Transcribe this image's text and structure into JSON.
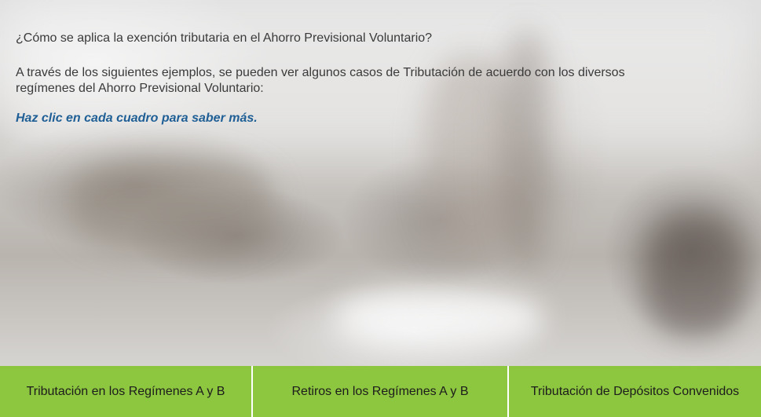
{
  "content": {
    "question": "¿Cómo se aplica la exención tributaria en el Ahorro Previsional Voluntario?",
    "intro_line1": "A través de los siguientes ejemplos, se pueden ver algunos casos de Tributación de acuerdo con los diversos",
    "intro_line2": "regímenes del Ahorro Previsional Voluntario:",
    "cta": "Haz clic en cada cuadro para saber más."
  },
  "tabs": [
    {
      "label": "Tributación en los Regímenes A y B"
    },
    {
      "label": "Retiros en los Regímenes A y B"
    },
    {
      "label": "Tributación de Depósitos Convenidos"
    }
  ],
  "colors": {
    "tab_background": "#8dc63f",
    "cta_text": "#1f5f95",
    "body_text": "#3a3a3a"
  }
}
